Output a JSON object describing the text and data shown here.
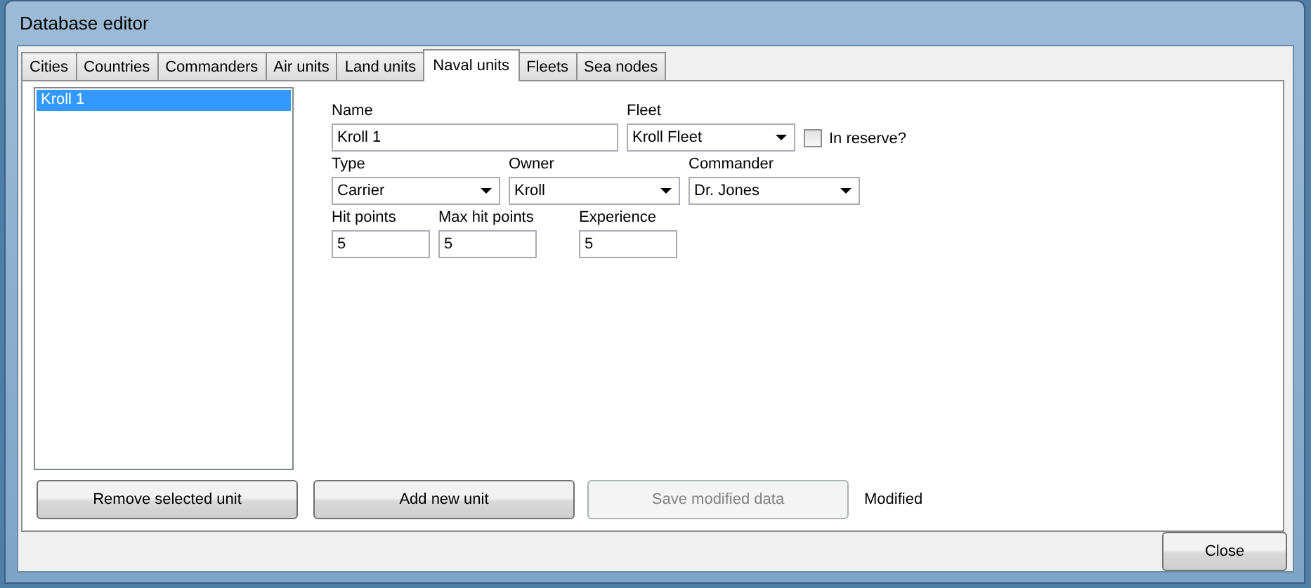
{
  "window": {
    "title": "Database editor"
  },
  "tabs": [
    {
      "label": "Cities",
      "selected": false
    },
    {
      "label": "Countries",
      "selected": false
    },
    {
      "label": "Commanders",
      "selected": false
    },
    {
      "label": "Air units",
      "selected": false
    },
    {
      "label": "Land units",
      "selected": false
    },
    {
      "label": "Naval units",
      "selected": true
    },
    {
      "label": "Fleets",
      "selected": false
    },
    {
      "label": "Sea nodes",
      "selected": false
    }
  ],
  "unit_list": {
    "items": [
      {
        "label": "Kroll 1",
        "selected": true
      }
    ]
  },
  "form": {
    "name": {
      "label": "Name",
      "value": "Kroll 1"
    },
    "fleet": {
      "label": "Fleet",
      "value": "Kroll Fleet"
    },
    "in_reserve": {
      "label": "In reserve?",
      "checked": false
    },
    "type": {
      "label": "Type",
      "value": "Carrier"
    },
    "owner": {
      "label": "Owner",
      "value": "Kroll"
    },
    "commander": {
      "label": "Commander",
      "value": "Dr. Jones"
    },
    "hit_points": {
      "label": "Hit points",
      "value": "5"
    },
    "max_hit_points": {
      "label": "Max hit points",
      "value": "5"
    },
    "experience": {
      "label": "Experience",
      "value": "5"
    }
  },
  "buttons": [
    {
      "label": "Remove selected unit",
      "disabled": false
    },
    {
      "label": "Add new unit",
      "disabled": false
    },
    {
      "label": "Save modified data",
      "disabled": true
    }
  ],
  "status": "Modified",
  "close_button": {
    "label": "Close"
  }
}
